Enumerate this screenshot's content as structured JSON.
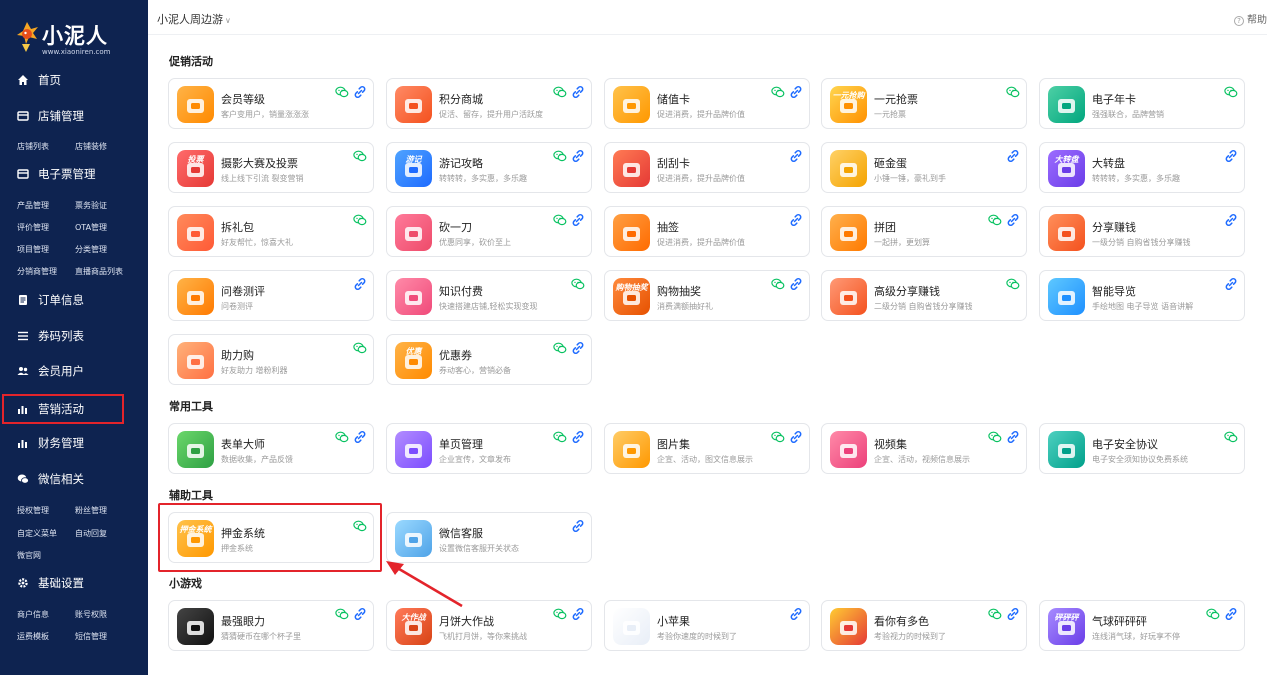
{
  "brand": {
    "name": "小泥人",
    "url": "www.xiaoniren.com"
  },
  "topbar": {
    "shop_name": "小泥人周边游",
    "help_label": "帮助"
  },
  "nav": {
    "home": "首页",
    "store": {
      "label": "店铺管理",
      "subs": [
        "店铺列表",
        "店铺装修"
      ]
    },
    "ticket": {
      "label": "电子票管理",
      "subs": [
        "产品管理",
        "票务验证",
        "评价管理",
        "OTA管理",
        "项目管理",
        "分类管理",
        "分销商管理",
        "直播商品列表"
      ]
    },
    "orders": "订单信息",
    "codes": "券码列表",
    "members": "会员用户",
    "marketing": "营销活动",
    "finance": "财务管理",
    "wechat": {
      "label": "微信相关",
      "subs": [
        "授权管理",
        "粉丝管理",
        "自定义菜单",
        "自动回复",
        "微官网"
      ]
    },
    "settings": {
      "label": "基础设置",
      "subs": [
        "商户信息",
        "账号权限",
        "运费模板",
        "短信管理"
      ]
    }
  },
  "sections": {
    "promo": "促销活动",
    "tools": "常用工具",
    "aux": "辅助工具",
    "games": "小游戏"
  },
  "colors": {
    "sidebar_bg": "#0e2350",
    "highlight": "#e3242b",
    "wechat_green": "#07c160",
    "link_blue": "#1e6bff"
  },
  "cards": {
    "promo": [
      {
        "name": "会员等级",
        "desc": "客户变用户，销量涨涨涨",
        "icon": "member-level-icon",
        "thumb_text": ""
      },
      {
        "name": "积分商城",
        "desc": "促活、留存，提升用户活跃度",
        "icon": "points-mall-icon",
        "thumb_text": ""
      },
      {
        "name": "储值卡",
        "desc": "促进消费，提升品牌价值",
        "icon": "stored-value-card-icon",
        "thumb_text": ""
      },
      {
        "name": "一元抢票",
        "desc": "一元抢票",
        "icon": "one-yuan-ticket-icon",
        "thumb_text": "一元抢购"
      },
      {
        "name": "电子年卡",
        "desc": "强强联合，品牌营销",
        "icon": "annual-card-icon",
        "thumb_text": ""
      },
      {
        "name": "摄影大赛及投票",
        "desc": "线上线下引流 裂变营销",
        "icon": "photo-contest-icon",
        "thumb_text": "投票"
      },
      {
        "name": "游记攻略",
        "desc": "转转转，多实惠，多乐趣",
        "icon": "travel-guide-icon",
        "thumb_text": "游记"
      },
      {
        "name": "刮刮卡",
        "desc": "促进消费，提升品牌价值",
        "icon": "scratch-card-icon",
        "thumb_text": ""
      },
      {
        "name": "砸金蛋",
        "desc": "小锤一锤，豪礼到手",
        "icon": "golden-egg-icon",
        "thumb_text": ""
      },
      {
        "name": "大转盘",
        "desc": "转转转，多实惠，多乐趣",
        "icon": "big-wheel-icon",
        "thumb_text": "大转盘"
      },
      {
        "name": "拆礼包",
        "desc": "好友帮忙，惊喜大礼",
        "icon": "gift-pack-icon",
        "thumb_text": ""
      },
      {
        "name": "砍一刀",
        "desc": "优惠同享，砍价至上",
        "icon": "bargain-icon",
        "thumb_text": ""
      },
      {
        "name": "抽签",
        "desc": "促进消费，提升品牌价值",
        "icon": "lottery-draw-icon",
        "thumb_text": ""
      },
      {
        "name": "拼团",
        "desc": "一起拼，更划算",
        "icon": "group-buy-icon",
        "thumb_text": ""
      },
      {
        "name": "分享赚钱",
        "desc": "一级分销 自购省钱分享赚钱",
        "icon": "share-earn-icon",
        "thumb_text": ""
      },
      {
        "name": "问卷测评",
        "desc": "问卷测评",
        "icon": "survey-icon",
        "thumb_text": ""
      },
      {
        "name": "知识付费",
        "desc": "快速搭建店铺,轻松实现变现",
        "icon": "paid-knowledge-icon",
        "thumb_text": ""
      },
      {
        "name": "购物抽奖",
        "desc": "消费满额抽好礼",
        "icon": "shopping-lottery-icon",
        "thumb_text": "购物抽奖"
      },
      {
        "name": "高级分享赚钱",
        "desc": "二级分销 自购省钱分享赚钱",
        "icon": "advanced-share-icon",
        "thumb_text": ""
      },
      {
        "name": "智能导览",
        "desc": "手绘地图 电子导览 语音讲解",
        "icon": "smart-guide-icon",
        "thumb_text": ""
      },
      {
        "name": "助力购",
        "desc": "好友助力 增粉利器",
        "icon": "assist-buy-icon",
        "thumb_text": ""
      },
      {
        "name": "优惠券",
        "desc": "券动客心，营销必备",
        "icon": "coupon-icon",
        "thumb_text": "优惠"
      }
    ],
    "tools": [
      {
        "name": "表单大师",
        "desc": "数据收集，产品反馈",
        "icon": "form-master-icon",
        "thumb_text": ""
      },
      {
        "name": "单页管理",
        "desc": "企业宣传，文章发布",
        "icon": "single-page-icon",
        "thumb_text": ""
      },
      {
        "name": "图片集",
        "desc": "企宣、活动，图文信息展示",
        "icon": "image-gallery-icon",
        "thumb_text": ""
      },
      {
        "name": "视频集",
        "desc": "企宣、活动，视频信息展示",
        "icon": "video-gallery-icon",
        "thumb_text": ""
      },
      {
        "name": "电子安全协议",
        "desc": "电子安全须知协议免费系统",
        "icon": "safety-agreement-icon",
        "thumb_text": ""
      }
    ],
    "aux": [
      {
        "name": "押金系统",
        "desc": "押金系统",
        "icon": "deposit-system-icon",
        "thumb_text": "押金系统"
      },
      {
        "name": "微信客服",
        "desc": "设置微信客服开关状态",
        "icon": "wechat-service-icon",
        "thumb_text": ""
      }
    ],
    "games": [
      {
        "name": "最强眼力",
        "desc": "猜猜硬币在哪个杯子里",
        "icon": "sharp-eye-icon",
        "thumb_text": ""
      },
      {
        "name": "月饼大作战",
        "desc": "飞机打月饼，等你来挑战",
        "icon": "mooncake-battle-icon",
        "thumb_text": "大作战"
      },
      {
        "name": "小苹果",
        "desc": "考验你速度的时候到了",
        "icon": "little-apple-icon",
        "thumb_text": ""
      },
      {
        "name": "看你有多色",
        "desc": "考验视力的时候到了",
        "icon": "color-test-icon",
        "thumb_text": ""
      },
      {
        "name": "气球砰砰砰",
        "desc": "连线消气球，好玩享不停",
        "icon": "balloon-pop-icon",
        "thumb_text": "砰砰砰"
      }
    ]
  }
}
